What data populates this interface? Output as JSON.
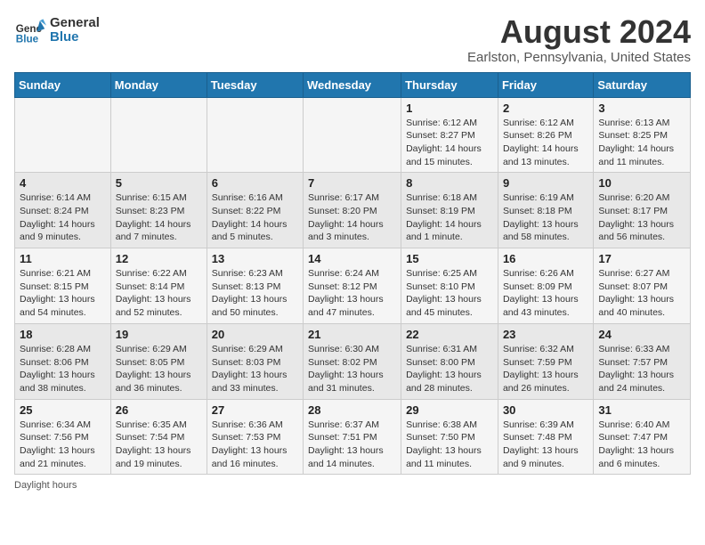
{
  "logo": {
    "line1": "General",
    "line2": "Blue"
  },
  "title": "August 2024",
  "subtitle": "Earlston, Pennsylvania, United States",
  "weekdays": [
    "Sunday",
    "Monday",
    "Tuesday",
    "Wednesday",
    "Thursday",
    "Friday",
    "Saturday"
  ],
  "footer": "Daylight hours",
  "weeks": [
    [
      {
        "day": "",
        "sunrise": "",
        "sunset": "",
        "daylight": ""
      },
      {
        "day": "",
        "sunrise": "",
        "sunset": "",
        "daylight": ""
      },
      {
        "day": "",
        "sunrise": "",
        "sunset": "",
        "daylight": ""
      },
      {
        "day": "",
        "sunrise": "",
        "sunset": "",
        "daylight": ""
      },
      {
        "day": "1",
        "sunrise": "Sunrise: 6:12 AM",
        "sunset": "Sunset: 8:27 PM",
        "daylight": "Daylight: 14 hours and 15 minutes."
      },
      {
        "day": "2",
        "sunrise": "Sunrise: 6:12 AM",
        "sunset": "Sunset: 8:26 PM",
        "daylight": "Daylight: 14 hours and 13 minutes."
      },
      {
        "day": "3",
        "sunrise": "Sunrise: 6:13 AM",
        "sunset": "Sunset: 8:25 PM",
        "daylight": "Daylight: 14 hours and 11 minutes."
      }
    ],
    [
      {
        "day": "4",
        "sunrise": "Sunrise: 6:14 AM",
        "sunset": "Sunset: 8:24 PM",
        "daylight": "Daylight: 14 hours and 9 minutes."
      },
      {
        "day": "5",
        "sunrise": "Sunrise: 6:15 AM",
        "sunset": "Sunset: 8:23 PM",
        "daylight": "Daylight: 14 hours and 7 minutes."
      },
      {
        "day": "6",
        "sunrise": "Sunrise: 6:16 AM",
        "sunset": "Sunset: 8:22 PM",
        "daylight": "Daylight: 14 hours and 5 minutes."
      },
      {
        "day": "7",
        "sunrise": "Sunrise: 6:17 AM",
        "sunset": "Sunset: 8:20 PM",
        "daylight": "Daylight: 14 hours and 3 minutes."
      },
      {
        "day": "8",
        "sunrise": "Sunrise: 6:18 AM",
        "sunset": "Sunset: 8:19 PM",
        "daylight": "Daylight: 14 hours and 1 minute."
      },
      {
        "day": "9",
        "sunrise": "Sunrise: 6:19 AM",
        "sunset": "Sunset: 8:18 PM",
        "daylight": "Daylight: 13 hours and 58 minutes."
      },
      {
        "day": "10",
        "sunrise": "Sunrise: 6:20 AM",
        "sunset": "Sunset: 8:17 PM",
        "daylight": "Daylight: 13 hours and 56 minutes."
      }
    ],
    [
      {
        "day": "11",
        "sunrise": "Sunrise: 6:21 AM",
        "sunset": "Sunset: 8:15 PM",
        "daylight": "Daylight: 13 hours and 54 minutes."
      },
      {
        "day": "12",
        "sunrise": "Sunrise: 6:22 AM",
        "sunset": "Sunset: 8:14 PM",
        "daylight": "Daylight: 13 hours and 52 minutes."
      },
      {
        "day": "13",
        "sunrise": "Sunrise: 6:23 AM",
        "sunset": "Sunset: 8:13 PM",
        "daylight": "Daylight: 13 hours and 50 minutes."
      },
      {
        "day": "14",
        "sunrise": "Sunrise: 6:24 AM",
        "sunset": "Sunset: 8:12 PM",
        "daylight": "Daylight: 13 hours and 47 minutes."
      },
      {
        "day": "15",
        "sunrise": "Sunrise: 6:25 AM",
        "sunset": "Sunset: 8:10 PM",
        "daylight": "Daylight: 13 hours and 45 minutes."
      },
      {
        "day": "16",
        "sunrise": "Sunrise: 6:26 AM",
        "sunset": "Sunset: 8:09 PM",
        "daylight": "Daylight: 13 hours and 43 minutes."
      },
      {
        "day": "17",
        "sunrise": "Sunrise: 6:27 AM",
        "sunset": "Sunset: 8:07 PM",
        "daylight": "Daylight: 13 hours and 40 minutes."
      }
    ],
    [
      {
        "day": "18",
        "sunrise": "Sunrise: 6:28 AM",
        "sunset": "Sunset: 8:06 PM",
        "daylight": "Daylight: 13 hours and 38 minutes."
      },
      {
        "day": "19",
        "sunrise": "Sunrise: 6:29 AM",
        "sunset": "Sunset: 8:05 PM",
        "daylight": "Daylight: 13 hours and 36 minutes."
      },
      {
        "day": "20",
        "sunrise": "Sunrise: 6:29 AM",
        "sunset": "Sunset: 8:03 PM",
        "daylight": "Daylight: 13 hours and 33 minutes."
      },
      {
        "day": "21",
        "sunrise": "Sunrise: 6:30 AM",
        "sunset": "Sunset: 8:02 PM",
        "daylight": "Daylight: 13 hours and 31 minutes."
      },
      {
        "day": "22",
        "sunrise": "Sunrise: 6:31 AM",
        "sunset": "Sunset: 8:00 PM",
        "daylight": "Daylight: 13 hours and 28 minutes."
      },
      {
        "day": "23",
        "sunrise": "Sunrise: 6:32 AM",
        "sunset": "Sunset: 7:59 PM",
        "daylight": "Daylight: 13 hours and 26 minutes."
      },
      {
        "day": "24",
        "sunrise": "Sunrise: 6:33 AM",
        "sunset": "Sunset: 7:57 PM",
        "daylight": "Daylight: 13 hours and 24 minutes."
      }
    ],
    [
      {
        "day": "25",
        "sunrise": "Sunrise: 6:34 AM",
        "sunset": "Sunset: 7:56 PM",
        "daylight": "Daylight: 13 hours and 21 minutes."
      },
      {
        "day": "26",
        "sunrise": "Sunrise: 6:35 AM",
        "sunset": "Sunset: 7:54 PM",
        "daylight": "Daylight: 13 hours and 19 minutes."
      },
      {
        "day": "27",
        "sunrise": "Sunrise: 6:36 AM",
        "sunset": "Sunset: 7:53 PM",
        "daylight": "Daylight: 13 hours and 16 minutes."
      },
      {
        "day": "28",
        "sunrise": "Sunrise: 6:37 AM",
        "sunset": "Sunset: 7:51 PM",
        "daylight": "Daylight: 13 hours and 14 minutes."
      },
      {
        "day": "29",
        "sunrise": "Sunrise: 6:38 AM",
        "sunset": "Sunset: 7:50 PM",
        "daylight": "Daylight: 13 hours and 11 minutes."
      },
      {
        "day": "30",
        "sunrise": "Sunrise: 6:39 AM",
        "sunset": "Sunset: 7:48 PM",
        "daylight": "Daylight: 13 hours and 9 minutes."
      },
      {
        "day": "31",
        "sunrise": "Sunrise: 6:40 AM",
        "sunset": "Sunset: 7:47 PM",
        "daylight": "Daylight: 13 hours and 6 minutes."
      }
    ]
  ]
}
